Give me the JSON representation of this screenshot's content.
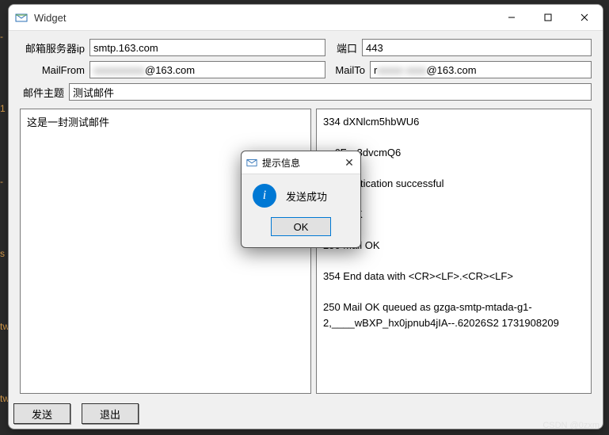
{
  "window": {
    "title": "Widget",
    "labels": {
      "server_ip": "邮箱服务器ip",
      "port": "端口",
      "mail_from": "MailFrom",
      "mail_to": "MailTo",
      "subject": "邮件主题"
    },
    "fields": {
      "server_ip": "smtp.163.com",
      "port": "443",
      "mail_from_hidden": "xxxxxxxxxx",
      "mail_from_suffix": "@163.com",
      "mail_to_prefix": "r",
      "mail_to_hidden": "xxxxx xxxx",
      "mail_to_suffix": "@163.com",
      "subject": "测试邮件"
    },
    "body_text": "这是一封测试邮件",
    "log_text": "334 dXNlcm5hbWU6\n\n    6Fzc3dvcmQ6\n\n    uthentication successful\n\n    ail OK\n\n250 Mail OK\n\n354 End data with <CR><LF>.<CR><LF>\n\n250 Mail OK queued as gzga-smtp-mtada-g1-2,____wBXP_hx0jpnub4jIA--.62026S2 1731908209",
    "buttons": {
      "send": "发送",
      "quit": "退出"
    }
  },
  "dialog": {
    "title": "提示信息",
    "message": "发送成功",
    "ok": "OK"
  },
  "watermark": "CSDN @0zxm"
}
